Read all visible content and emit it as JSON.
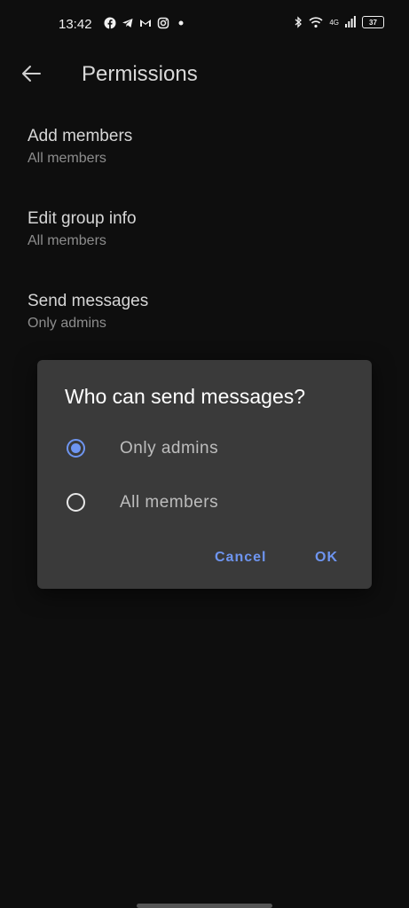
{
  "status_bar": {
    "time": "13:42",
    "apps": [
      "facebook-icon",
      "telegram-icon",
      "gmail-icon",
      "instagram-icon",
      "notification-dot-icon"
    ],
    "network": "4G",
    "battery": "37"
  },
  "app_bar": {
    "title": "Permissions"
  },
  "settings": [
    {
      "title": "Add members",
      "value": "All members"
    },
    {
      "title": "Edit group info",
      "value": "All members"
    },
    {
      "title": "Send messages",
      "value": "Only admins"
    }
  ],
  "dialog": {
    "title": "Who can send messages?",
    "options": [
      {
        "label": "Only admins",
        "selected": true
      },
      {
        "label": "All members",
        "selected": false
      }
    ],
    "cancel_label": "Cancel",
    "ok_label": "OK"
  },
  "colors": {
    "background": "#0e0e0e",
    "dialog": "#3a3a3a",
    "accent": "#6e95f0"
  }
}
